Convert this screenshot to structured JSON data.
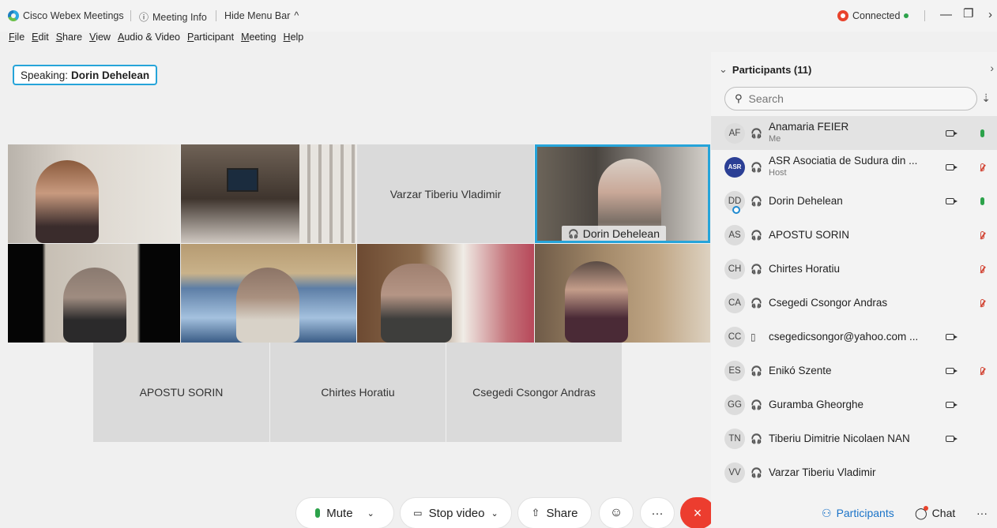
{
  "titlebar": {
    "app_name": "Cisco Webex Meetings",
    "meeting_info": "Meeting Info",
    "hide_menu": "Hide Menu Bar",
    "hide_menu_chevron": "^",
    "status": "Connected",
    "status_color": "#2ca24a"
  },
  "menu": [
    "File",
    "Edit",
    "Share",
    "View",
    "Audio & Video",
    "Participant",
    "Meeting",
    "Help"
  ],
  "speaking": {
    "prefix": "Speaking:",
    "name": "Dorin Dehelean"
  },
  "grid": {
    "name_tiles": [
      "Varzar Tiberiu Vladimir",
      "APOSTU SORIN",
      "Chirtes Horatiu",
      "Csegedi Csongor Andras"
    ],
    "active_speaker": "Dorin Dehelean"
  },
  "controls": {
    "mute": "Mute",
    "stop_video": "Stop video",
    "share": "Share",
    "reactions_icon": "emoji-icon",
    "more": "···",
    "end": "×"
  },
  "panel": {
    "title": "Participants (11)",
    "search_placeholder": "Search",
    "participants": [
      {
        "initials": "AF",
        "name": "Anamaria FEIER",
        "sub": "Me",
        "audio": "headset",
        "video": true,
        "mic": "on"
      },
      {
        "initials": "ASR",
        "name": "ASR Asociatia de Sudura din ...",
        "sub": "Host",
        "audio": "headset",
        "video": true,
        "mic": "off"
      },
      {
        "initials": "DD",
        "name": "Dorin Dehelean",
        "sub": "",
        "audio": "headset",
        "video": true,
        "mic": "on"
      },
      {
        "initials": "AS",
        "name": "APOSTU SORIN",
        "sub": "",
        "audio": "headset",
        "video": false,
        "mic": "off"
      },
      {
        "initials": "CH",
        "name": "Chirtes Horatiu",
        "sub": "",
        "audio": "headset",
        "video": false,
        "mic": "off"
      },
      {
        "initials": "CA",
        "name": "Csegedi Csongor Andras",
        "sub": "",
        "audio": "headset",
        "video": false,
        "mic": "off"
      },
      {
        "initials": "CC",
        "name": "csegedicsongor@yahoo.com ...",
        "sub": "",
        "audio": "phone",
        "video": true,
        "mic": "none"
      },
      {
        "initials": "ES",
        "name": "Enikó Szente",
        "sub": "",
        "audio": "headset",
        "video": true,
        "mic": "off"
      },
      {
        "initials": "GG",
        "name": "Guramba Gheorghe",
        "sub": "",
        "audio": "headset",
        "video": true,
        "mic": "none"
      },
      {
        "initials": "TN",
        "name": "Tiberiu Dimitrie Nicolaen NAN",
        "sub": "",
        "audio": "headset",
        "video": true,
        "mic": "none"
      },
      {
        "initials": "VV",
        "name": "Varzar Tiberiu Vladimir",
        "sub": "",
        "audio": "headset",
        "video": false,
        "mic": "none"
      }
    ]
  },
  "bottom_right": {
    "participants": "Participants",
    "chat": "Chat",
    "more": "···"
  }
}
